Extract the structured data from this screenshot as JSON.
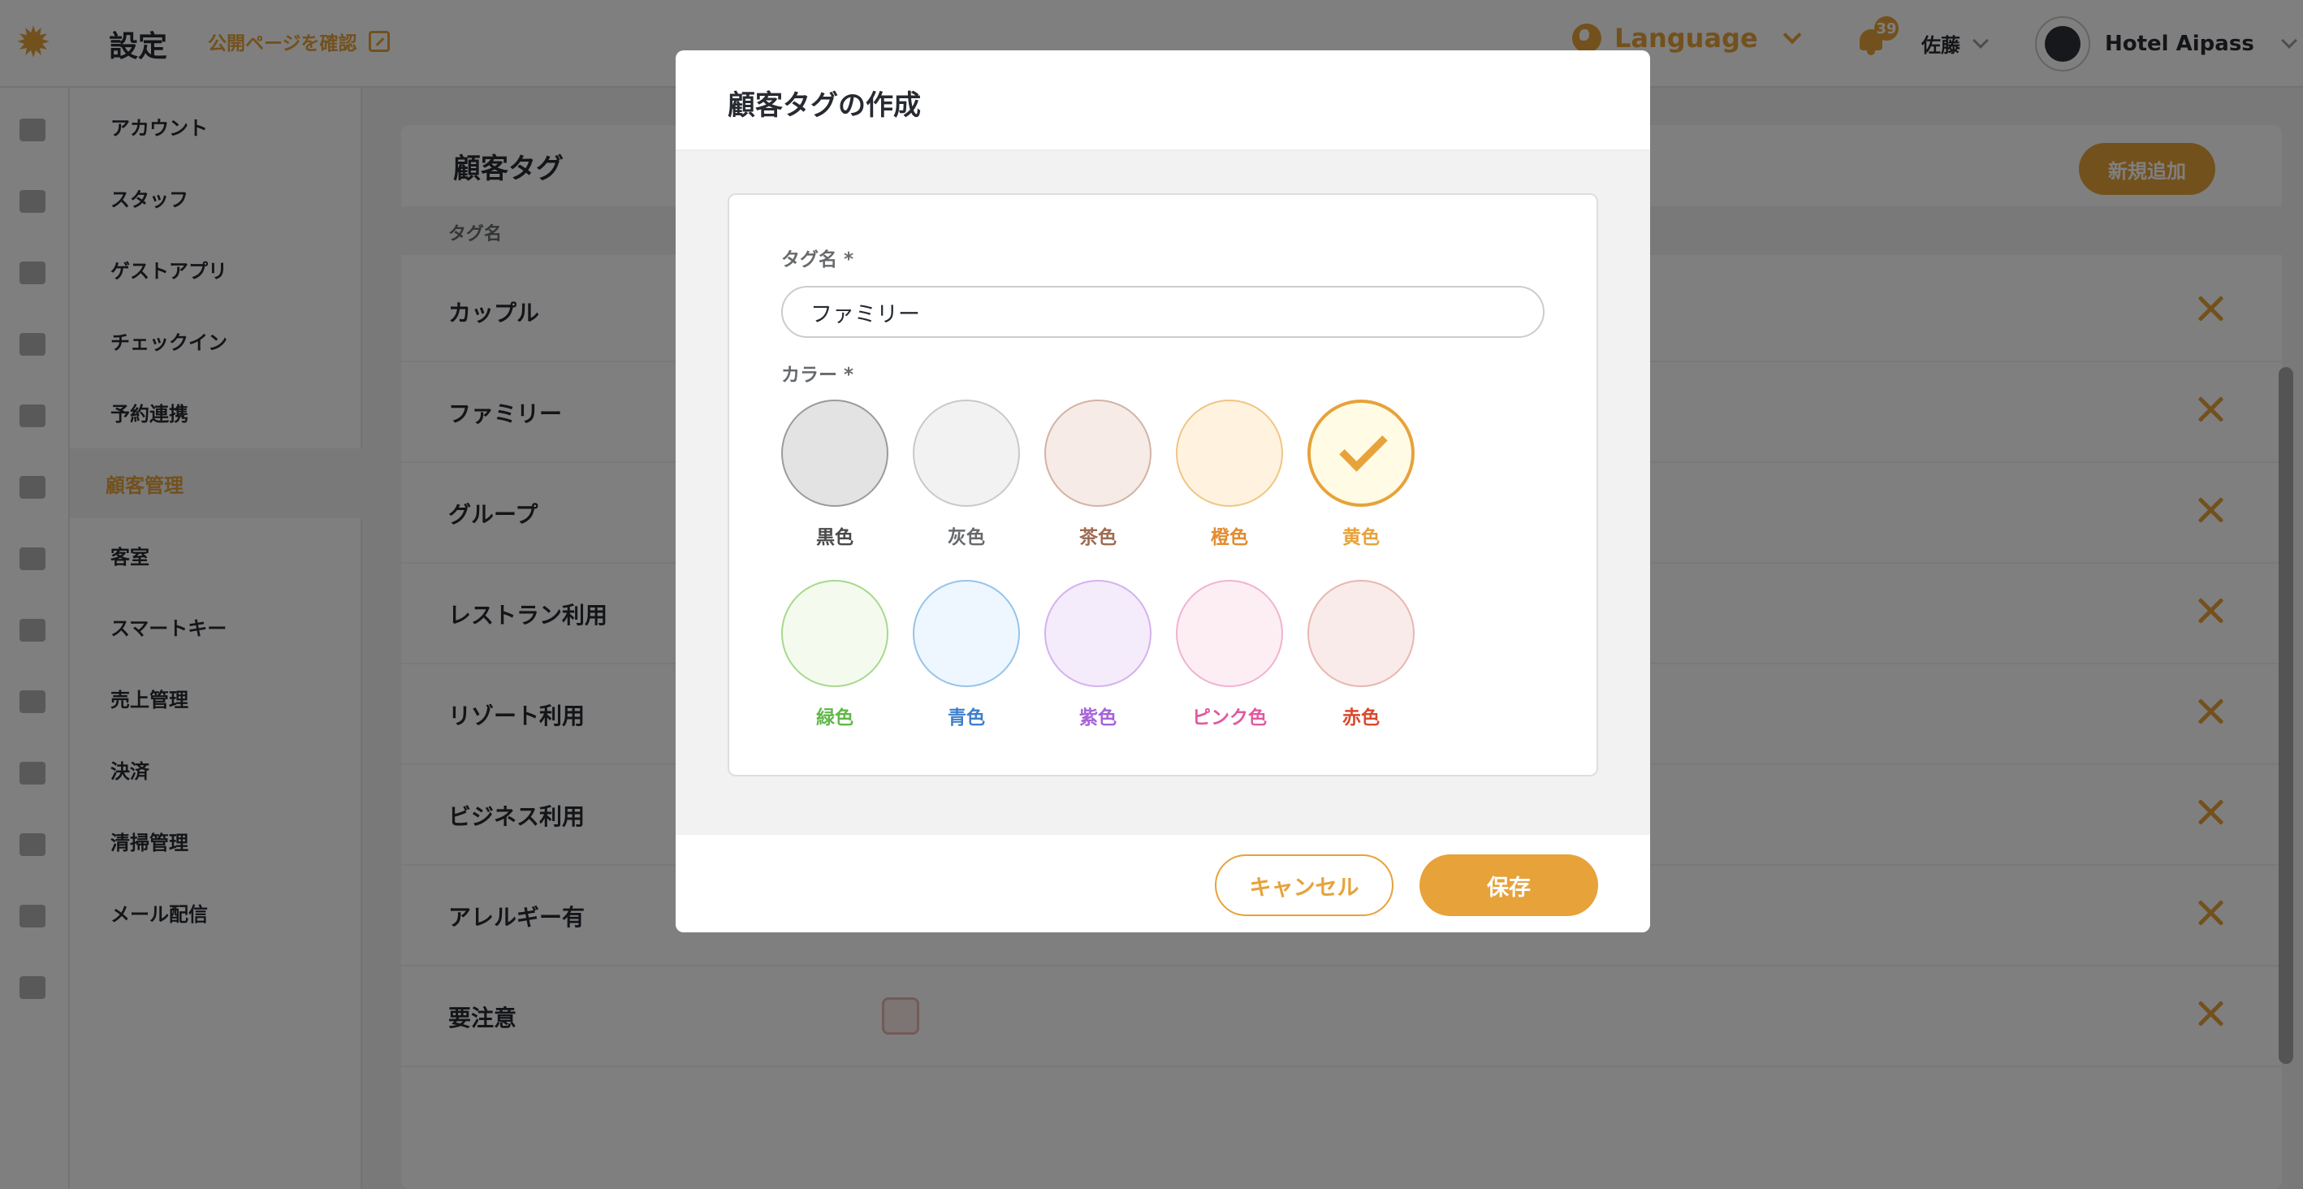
{
  "header": {
    "title": "設定",
    "public_link": "公開ページを確認",
    "language": "Language",
    "notification_count": "39",
    "user_name": "佐藤",
    "hotel_name": "Hotel Aipass"
  },
  "rail_icons": [
    "dashboard-icon",
    "bed-icon",
    "folder-user-icon",
    "building-icon",
    "calculator-icon",
    "megaphone-icon",
    "sofa-icon",
    "broom-icon",
    "ticket-icon",
    "mail-icon",
    "chart-icon",
    "newspaper-icon",
    "clock-icon"
  ],
  "sidebar": {
    "items": [
      {
        "label": "アカウント"
      },
      {
        "label": "スタッフ"
      },
      {
        "label": "ゲストアプリ"
      },
      {
        "label": "チェックイン"
      },
      {
        "label": "予約連携"
      },
      {
        "label": "顧客管理",
        "active": true
      },
      {
        "label": "客室"
      },
      {
        "label": "スマートキー"
      },
      {
        "label": "売上管理"
      },
      {
        "label": "決済"
      },
      {
        "label": "清掃管理"
      },
      {
        "label": "メール配信"
      }
    ]
  },
  "main": {
    "title": "顧客タグ",
    "add_button": "新規追加",
    "column_header": "タグ名",
    "rows": [
      {
        "name": "カップル"
      },
      {
        "name": "ファミリー"
      },
      {
        "name": "グループ"
      },
      {
        "name": "レストラン利用"
      },
      {
        "name": "リゾート利用"
      },
      {
        "name": "ビジネス利用"
      },
      {
        "name": "アレルギー有"
      },
      {
        "name": "要注意"
      }
    ]
  },
  "modal": {
    "title": "顧客タグの作成",
    "tag_name_label": "タグ名 *",
    "tag_name_value": "ファミリー",
    "color_label": "カラー *",
    "selected_color": "黄色",
    "colors": [
      {
        "label": "黒色",
        "fill": "#e3e3e3",
        "border": "#9b9b9b",
        "text": "#4a4a4a"
      },
      {
        "label": "灰色",
        "fill": "#f2f2f2",
        "border": "#c9c9c9",
        "text": "#676a6c"
      },
      {
        "label": "茶色",
        "fill": "#f6ebe6",
        "border": "#d4b2a4",
        "text": "#9e6b52"
      },
      {
        "label": "橙色",
        "fill": "#fff3e0",
        "border": "#f0c584",
        "text": "#e38b2e"
      },
      {
        "label": "黄色",
        "fill": "#fffbe5",
        "border": "#e7a23a",
        "text": "#e7a23a"
      },
      {
        "label": "緑色",
        "fill": "#f4fbee",
        "border": "#a6d98d",
        "text": "#62b84a"
      },
      {
        "label": "青色",
        "fill": "#eef6ff",
        "border": "#98c3ea",
        "text": "#3f7fcc"
      },
      {
        "label": "紫色",
        "fill": "#f4ebfb",
        "border": "#d4b2ee",
        "text": "#a663d8"
      },
      {
        "label": "ピンク色",
        "fill": "#fdeef4",
        "border": "#f1b3d0",
        "text": "#e05aa0"
      },
      {
        "label": "赤色",
        "fill": "#f9ebe9",
        "border": "#e8b7b0",
        "text": "#d94a2e"
      }
    ],
    "cancel_button": "キャンセル",
    "save_button": "保存"
  }
}
